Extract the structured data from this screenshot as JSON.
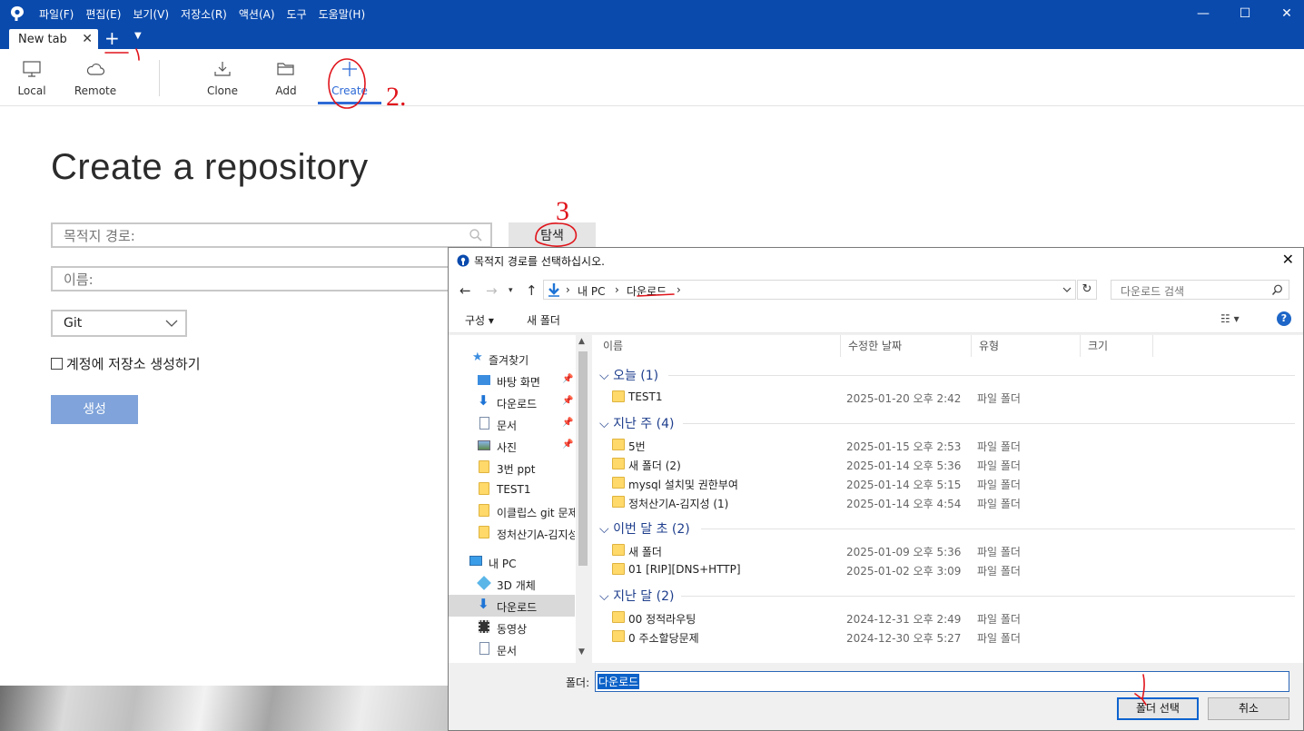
{
  "menu": [
    "파일(F)",
    "편집(E)",
    "보기(V)",
    "저장소(R)",
    "액션(A)",
    "도구",
    "도움말(H)"
  ],
  "window_controls": {
    "minimize": "—",
    "maximize": "☐",
    "close": "✕"
  },
  "tabs": [
    {
      "label": "New tab",
      "close": "✕"
    }
  ],
  "add_tab": "+",
  "toolbar": {
    "local": "Local",
    "remote": "Remote",
    "clone": "Clone",
    "add": "Add",
    "create": "Create",
    "accent": "#2d6ad6"
  },
  "page": {
    "title": "Create a repository",
    "dest_placeholder": "목적지 경로:",
    "name_placeholder": "이름:",
    "browse": "탐색",
    "vcs": "Git",
    "account_check": "계정에 저장소 생성하기",
    "create": "생성"
  },
  "dialog": {
    "title": "목적지 경로를 선택하십시오.",
    "close": "✕",
    "breadcrumb": [
      "내 PC",
      "다운로드"
    ],
    "crumb_sep": "›",
    "search_placeholder": "다운로드 검색",
    "organize": "구성 ▾",
    "new_folder": "새 폴더",
    "view": "☷ ▾",
    "help": "?",
    "nav": [
      {
        "label": "즐겨찾기",
        "icon": "star-icon"
      },
      {
        "label": "바탕 화면",
        "icon": "desktop-icon",
        "pinned": true
      },
      {
        "label": "다운로드",
        "icon": "download-icon",
        "pinned": true
      },
      {
        "label": "문서",
        "icon": "document-icon",
        "pinned": true
      },
      {
        "label": "사진",
        "icon": "picture-icon",
        "pinned": true
      },
      {
        "label": "3번 ppt",
        "icon": "folder-icon"
      },
      {
        "label": "TEST1",
        "icon": "folder-icon"
      },
      {
        "label": "이클립스 git 문제",
        "icon": "folder-icon"
      },
      {
        "label": "정처산기A-김지성",
        "icon": "folder-icon"
      },
      {
        "label": "내 PC",
        "icon": "pc-icon"
      },
      {
        "label": "3D 개체",
        "icon": "cube-icon"
      },
      {
        "label": "다운로드",
        "icon": "download-icon",
        "selected": true
      },
      {
        "label": "동영상",
        "icon": "video-icon"
      },
      {
        "label": "문서",
        "icon": "document-icon"
      }
    ],
    "columns": {
      "name": "이름",
      "modified": "수정한 날짜",
      "type": "유형",
      "size": "크기"
    },
    "groups": [
      {
        "label": "오늘 (1)",
        "files": [
          {
            "name": "TEST1",
            "date": "2025-01-20 오후 2:42",
            "type": "파일 폴더"
          }
        ]
      },
      {
        "label": "지난 주 (4)",
        "files": [
          {
            "name": "5번",
            "date": "2025-01-15 오후 2:53",
            "type": "파일 폴더"
          },
          {
            "name": "새 폴더 (2)",
            "date": "2025-01-14 오후 5:36",
            "type": "파일 폴더"
          },
          {
            "name": "mysql 설치및 권한부여",
            "date": "2025-01-14 오후 5:15",
            "type": "파일 폴더"
          },
          {
            "name": "정처산기A-김지성 (1)",
            "date": "2025-01-14 오후 4:54",
            "type": "파일 폴더"
          }
        ]
      },
      {
        "label": "이번 달 초 (2)",
        "files": [
          {
            "name": "새 폴더",
            "date": "2025-01-09 오후 5:36",
            "type": "파일 폴더"
          },
          {
            "name": "01 [RIP][DNS+HTTP]",
            "date": "2025-01-02 오후 3:09",
            "type": "파일 폴더"
          }
        ]
      },
      {
        "label": "지난 달 (2)",
        "files": [
          {
            "name": "00 정적라우팅",
            "date": "2024-12-31 오후 2:49",
            "type": "파일 폴더"
          },
          {
            "name": "0 주소할당문제",
            "date": "2024-12-30 오후 5:27",
            "type": "파일 폴더"
          }
        ]
      }
    ],
    "folder_label": "폴더:",
    "folder_value": "다운로드",
    "select_folder": "폴더 선택",
    "cancel": "취소"
  },
  "annotations": [
    "1.",
    "2.",
    "3"
  ],
  "colors": {
    "titlebar": "#0a4aad",
    "annotation": "#e0141b",
    "create_button": "#7fa3da"
  }
}
